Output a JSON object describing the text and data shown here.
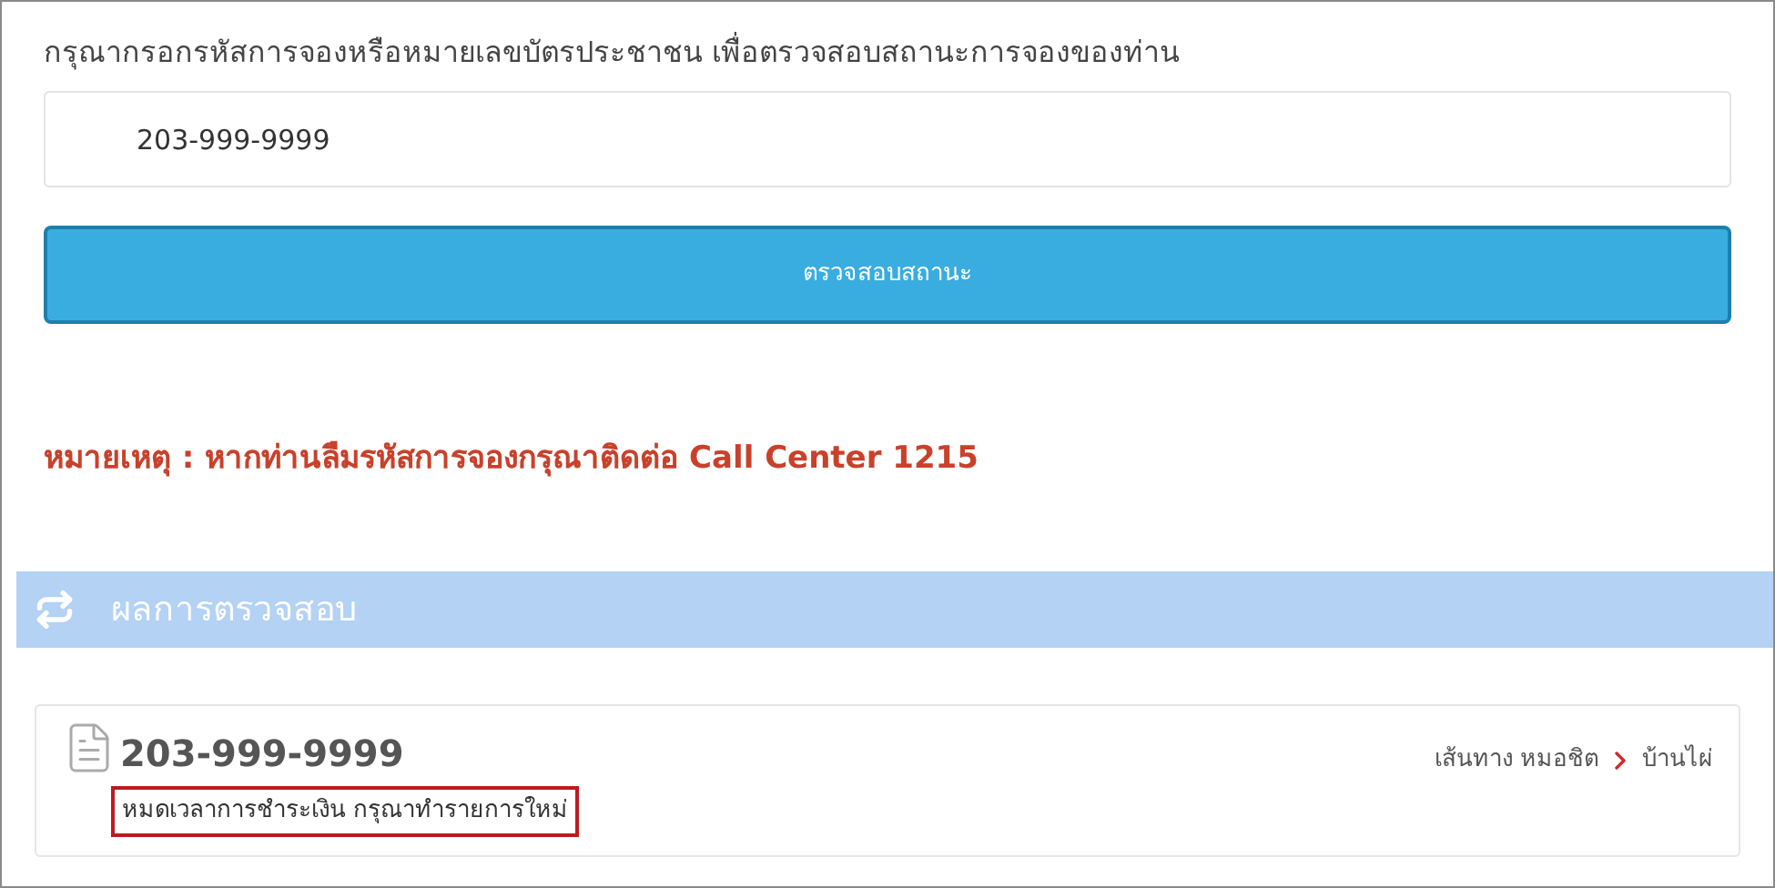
{
  "prompt": "กรุณากรอกรหัสการจองหรือหมายเลขบัตรประชาชน เพื่อตรวจสอบสถานะการจองของท่าน",
  "search": {
    "value": "203-999-9999"
  },
  "check_button": "ตรวจสอบสถานะ",
  "note": "หมายเหตุ : หากท่านลืมรหัสการจองกรุณาติดต่อ Call Center 1215",
  "results": {
    "title": "ผลการตรวจสอบ",
    "items": [
      {
        "code": "203-999-9999",
        "route_label": "เส้นทาง",
        "origin": "หมอชิต",
        "destination": "บ้านไผ่",
        "message": "หมดเวลาการชำระเงิน กรุณาทำรายการใหม่"
      }
    ]
  }
}
